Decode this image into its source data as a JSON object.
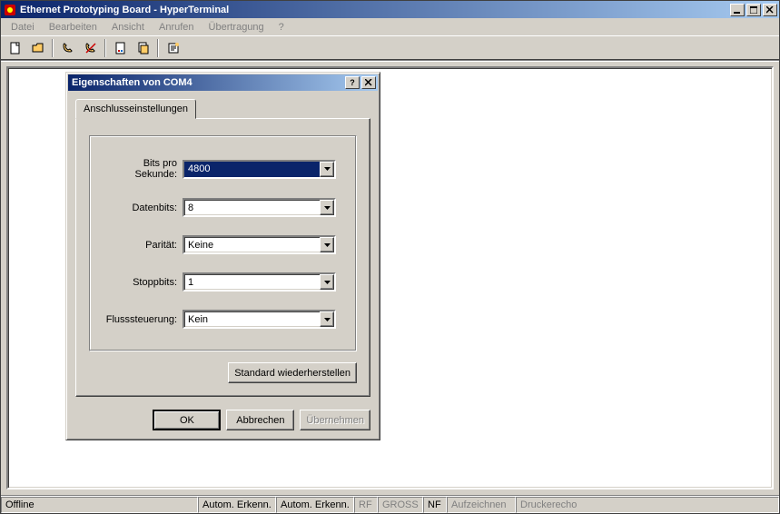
{
  "window": {
    "title": "Ethernet Prototyping Board - HyperTerminal"
  },
  "menu": {
    "file": "Datei",
    "edit": "Bearbeiten",
    "view": "Ansicht",
    "call": "Anrufen",
    "transfer": "Übertragung",
    "help": "?"
  },
  "dialog": {
    "title": "Eigenschaften von COM4",
    "tab": "Anschlusseinstellungen",
    "fields": {
      "baud_label": "Bits pro Sekunde:",
      "baud_value": "4800",
      "databits_label": "Datenbits:",
      "databits_value": "8",
      "parity_label": "Parität:",
      "parity_value": "Keine",
      "stopbits_label": "Stoppbits:",
      "stopbits_value": "1",
      "flow_label": "Flusssteuerung:",
      "flow_value": "Kein"
    },
    "restore_btn": "Standard wiederherstellen",
    "ok_btn": "OK",
    "cancel_btn": "Abbrechen",
    "apply_btn": "Übernehmen"
  },
  "status": {
    "connection": "Offline",
    "auto1": "Autom. Erkenn.",
    "auto2": "Autom. Erkenn.",
    "rf": "RF",
    "gross": "GROSS",
    "nf": "NF",
    "record": "Aufzeichnen",
    "echo": "Druckerecho"
  }
}
